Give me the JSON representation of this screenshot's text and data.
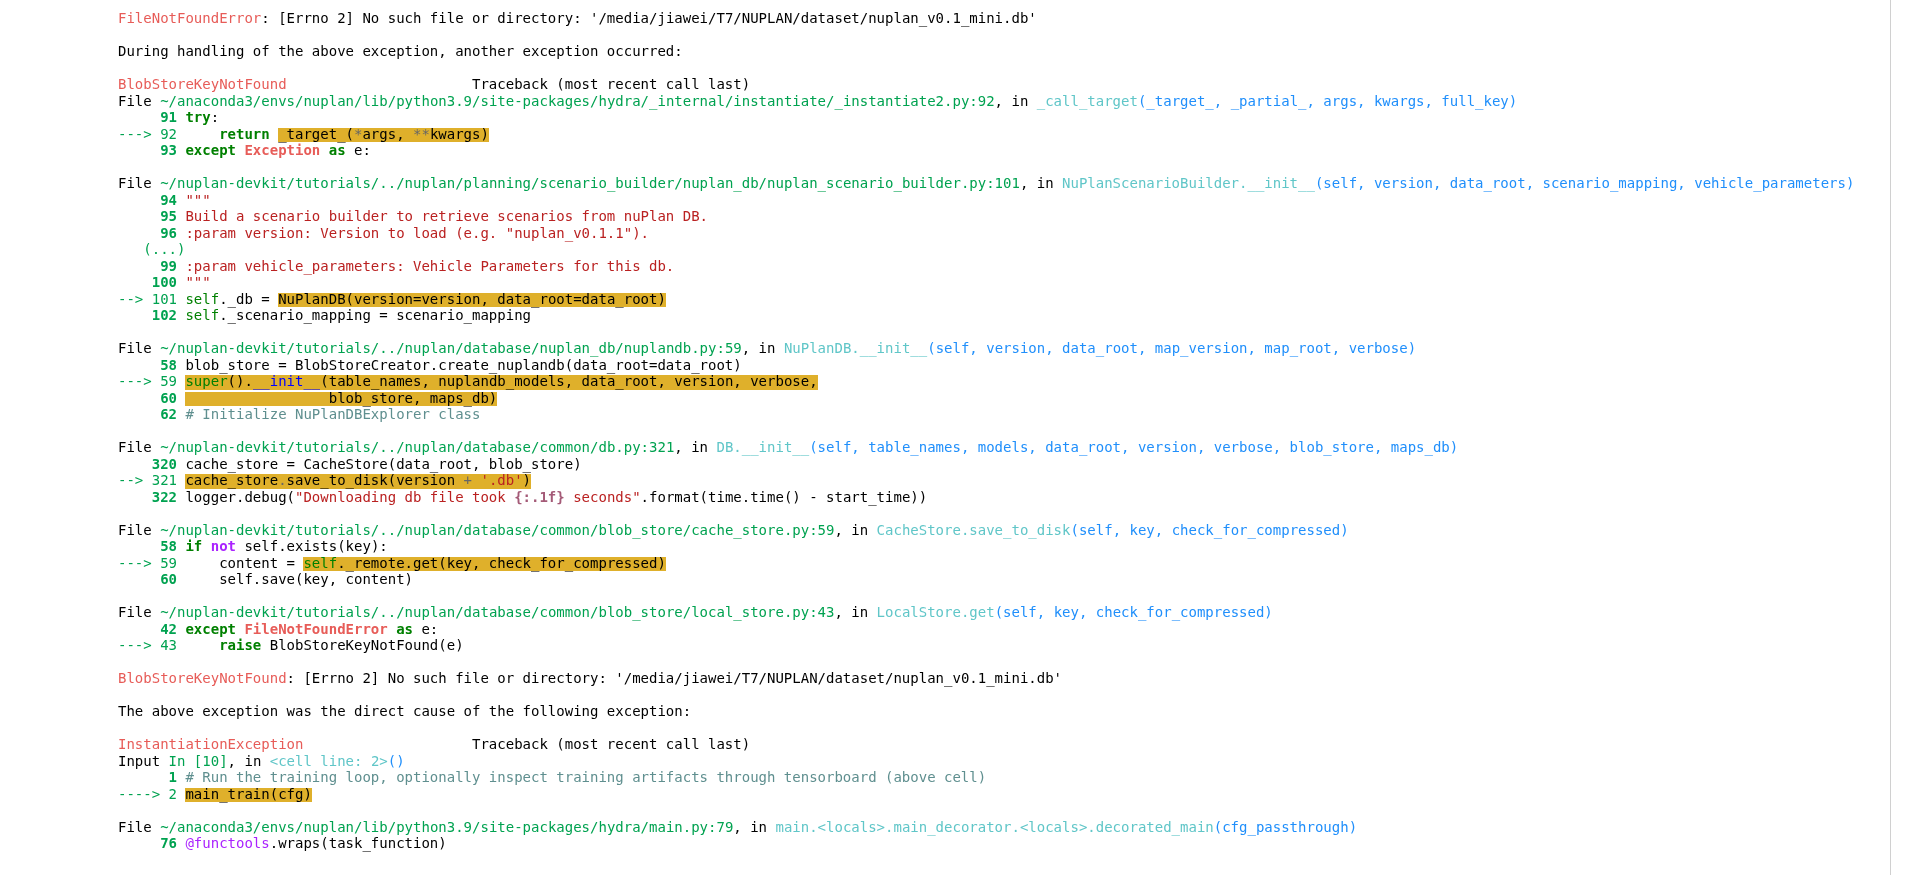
{
  "blocks": [
    {
      "lines": [
        {
          "kind": "text",
          "segments": [
            {
              "text": "FileNotFoundError",
              "kind": "ename",
              "highlighted": false
            },
            {
              "text": ": [Errno 2] No such file or directory: '/media/jiawei/T7/NUPLAN/dataset/nuplan_v0.1_mini.db'",
              "kind": "plain",
              "highlighted": false
            }
          ]
        }
      ]
    },
    {
      "lines": [
        {
          "kind": "text",
          "segments": [
            {
              "text": "During handling of the above exception, another exception occurred:",
              "kind": "plain",
              "highlighted": false
            }
          ]
        }
      ]
    },
    {
      "lines": [
        {
          "kind": "header",
          "exception": "BlobStoreKeyNotFound",
          "label": "Traceback (most recent call last)"
        },
        {
          "kind": "text",
          "segments": [
            {
              "text": "File ",
              "kind": "plain",
              "highlighted": false
            },
            {
              "text": "~/anaconda3/envs/nuplan/lib/python3.9/site-packages/hydra/_internal/instantiate/_instantiate2.py:92",
              "kind": "path",
              "highlighted": false
            },
            {
              "text": ", in ",
              "kind": "plain",
              "highlighted": false
            },
            {
              "text": "_call_target",
              "kind": "func",
              "highlighted": false
            },
            {
              "text": "(_target_, _partial_, args, kwargs, full_key)",
              "kind": "args",
              "highlighted": false
            }
          ]
        },
        {
          "kind": "code",
          "number": "91",
          "segments": [
            {
              "text": "try",
              "kind": "keyword",
              "highlighted": false
            },
            {
              "text": ":",
              "kind": "plain",
              "highlighted": false
            }
          ]
        },
        {
          "kind": "code",
          "arrow": "--->",
          "number": "92",
          "segments": [
            {
              "text": "    return ",
              "kind": "keyword",
              "highlighted": false
            },
            {
              "text": "_target_(",
              "kind": "plain",
              "highlighted": true
            },
            {
              "text": "*",
              "kind": "operator",
              "highlighted": true
            },
            {
              "text": "args, ",
              "kind": "plain",
              "highlighted": true
            },
            {
              "text": "**",
              "kind": "operator",
              "highlighted": true
            },
            {
              "text": "kwargs)",
              "kind": "plain",
              "highlighted": true
            }
          ]
        },
        {
          "kind": "code",
          "number": "93",
          "segments": [
            {
              "text": "except ",
              "kind": "keyword",
              "highlighted": false
            },
            {
              "text": "Exception ",
              "kind": "exception",
              "highlighted": false
            },
            {
              "text": "as",
              "kind": "keyword",
              "highlighted": false
            },
            {
              "text": " e:",
              "kind": "plain",
              "highlighted": false
            }
          ]
        }
      ]
    },
    {
      "lines": [
        {
          "kind": "text",
          "segments": [
            {
              "text": "File ",
              "kind": "plain",
              "highlighted": false
            },
            {
              "text": "~/nuplan-devkit/tutorials/../nuplan/planning/scenario_builder/nuplan_db/nuplan_scenario_builder.py:101",
              "kind": "path",
              "highlighted": false
            },
            {
              "text": ", in ",
              "kind": "plain",
              "highlighted": false
            },
            {
              "text": "NuPlanScenarioBuilder.__init__",
              "kind": "func",
              "highlighted": false
            },
            {
              "text": "(self, version, data_root, scenario_mapping, vehicle_parameters)",
              "kind": "args",
              "highlighted": false
            }
          ]
        },
        {
          "kind": "code",
          "number": "94",
          "segments": [
            {
              "text": "\"\"\"",
              "kind": "string",
              "highlighted": false
            }
          ]
        },
        {
          "kind": "code",
          "number": "95",
          "segments": [
            {
              "text": "Build a scenario builder to retrieve scenarios from nuPlan DB.",
              "kind": "string",
              "highlighted": false
            }
          ]
        },
        {
          "kind": "code",
          "number": "96",
          "segments": [
            {
              "text": ":param version: Version to load (e.g. \"nuplan_v0.1.1\").",
              "kind": "string",
              "highlighted": false
            }
          ]
        },
        {
          "kind": "ellipsis",
          "text": "(...)"
        },
        {
          "kind": "code",
          "number": "99",
          "segments": [
            {
              "text": ":param vehicle_parameters: Vehicle Parameters for this db.",
              "kind": "string",
              "highlighted": false
            }
          ]
        },
        {
          "kind": "code",
          "number": "100",
          "segments": [
            {
              "text": "\"\"\"",
              "kind": "string",
              "highlighted": false
            }
          ]
        },
        {
          "kind": "code",
          "arrow": "-->",
          "number": "101",
          "segments": [
            {
              "text": "self",
              "kind": "builtin",
              "highlighted": false
            },
            {
              "text": "._db = ",
              "kind": "plain",
              "highlighted": false
            },
            {
              "text": "NuPlanDB(version=version, data_root=data_root)",
              "kind": "plain",
              "highlighted": true
            }
          ]
        },
        {
          "kind": "code",
          "number": "102",
          "segments": [
            {
              "text": "self",
              "kind": "builtin",
              "highlighted": false
            },
            {
              "text": "._scenario_mapping = scenario_mapping",
              "kind": "plain",
              "highlighted": false
            }
          ]
        }
      ]
    },
    {
      "lines": [
        {
          "kind": "text",
          "segments": [
            {
              "text": "File ",
              "kind": "plain",
              "highlighted": false
            },
            {
              "text": "~/nuplan-devkit/tutorials/../nuplan/database/nuplan_db/nuplandb.py:59",
              "kind": "path",
              "highlighted": false
            },
            {
              "text": ", in ",
              "kind": "plain",
              "highlighted": false
            },
            {
              "text": "NuPlanDB.__init__",
              "kind": "func",
              "highlighted": false
            },
            {
              "text": "(self, version, data_root, map_version, map_root, verbose)",
              "kind": "args",
              "highlighted": false
            }
          ]
        },
        {
          "kind": "code",
          "number": "58",
          "segments": [
            {
              "text": "blob_store = BlobStoreCreator.create_nuplandb(data_root=data_root)",
              "kind": "plain",
              "highlighted": false
            }
          ]
        },
        {
          "kind": "code",
          "arrow": "--->",
          "number": "59",
          "segments": [
            {
              "text": "super",
              "kind": "builtin",
              "highlighted": true
            },
            {
              "text": "().",
              "kind": "plain",
              "highlighted": true
            },
            {
              "text": "__init__",
              "kind": "dunder",
              "highlighted": true
            },
            {
              "text": "(table_names, nuplandb_models, data_root, version, verbose,",
              "kind": "plain",
              "highlighted": true
            }
          ]
        },
        {
          "kind": "code",
          "number": "60",
          "segments": [
            {
              "text": "                 blob_store, maps_db)",
              "kind": "plain",
              "highlighted": true
            }
          ]
        },
        {
          "kind": "code",
          "number": "62",
          "segments": [
            {
              "text": "# Initialize NuPlanDBExplorer class",
              "kind": "comment",
              "highlighted": false
            }
          ]
        }
      ]
    },
    {
      "lines": [
        {
          "kind": "text",
          "segments": [
            {
              "text": "File ",
              "kind": "plain",
              "highlighted": false
            },
            {
              "text": "~/nuplan-devkit/tutorials/../nuplan/database/common/db.py:321",
              "kind": "path",
              "highlighted": false
            },
            {
              "text": ", in ",
              "kind": "plain",
              "highlighted": false
            },
            {
              "text": "DB.__init__",
              "kind": "func",
              "highlighted": false
            },
            {
              "text": "(self, table_names, models, data_root, version, verbose, blob_store, maps_db)",
              "kind": "args",
              "highlighted": false
            }
          ]
        },
        {
          "kind": "code",
          "number": "320",
          "segments": [
            {
              "text": "cache_store = CacheStore(data_root, blob_store)",
              "kind": "plain",
              "highlighted": false
            }
          ]
        },
        {
          "kind": "code",
          "arrow": "-->",
          "number": "321",
          "segments": [
            {
              "text": "cache_store",
              "kind": "plain",
              "highlighted": true
            },
            {
              "text": ".",
              "kind": "operator",
              "highlighted": true
            },
            {
              "text": "save_to_disk(version ",
              "kind": "plain",
              "highlighted": true
            },
            {
              "text": "+ ",
              "kind": "operator",
              "highlighted": true
            },
            {
              "text": "'.db'",
              "kind": "string",
              "highlighted": true
            },
            {
              "text": ")",
              "kind": "plain",
              "highlighted": true
            }
          ]
        },
        {
          "kind": "code",
          "number": "322",
          "segments": [
            {
              "text": "logger.debug(",
              "kind": "plain",
              "highlighted": false
            },
            {
              "text": "\"Downloading db file took ",
              "kind": "string",
              "highlighted": false
            },
            {
              "text": "{:.1f}",
              "kind": "interpolation",
              "highlighted": false
            },
            {
              "text": " seconds\"",
              "kind": "string",
              "highlighted": false
            },
            {
              "text": ".format(time.time() - start_time))",
              "kind": "plain",
              "highlighted": false
            }
          ]
        }
      ]
    },
    {
      "lines": [
        {
          "kind": "text",
          "segments": [
            {
              "text": "File ",
              "kind": "plain",
              "highlighted": false
            },
            {
              "text": "~/nuplan-devkit/tutorials/../nuplan/database/common/blob_store/cache_store.py:59",
              "kind": "path",
              "highlighted": false
            },
            {
              "text": ", in ",
              "kind": "plain",
              "highlighted": false
            },
            {
              "text": "CacheStore.save_to_disk",
              "kind": "func",
              "highlighted": false
            },
            {
              "text": "(self, key, check_for_compressed)",
              "kind": "args",
              "highlighted": false
            }
          ]
        },
        {
          "kind": "code",
          "number": "58",
          "segments": [
            {
              "text": "if ",
              "kind": "keyword",
              "highlighted": false
            },
            {
              "text": "not",
              "kind": "wordop",
              "highlighted": false
            },
            {
              "text": " self.exists(key):",
              "kind": "plain",
              "highlighted": false
            }
          ]
        },
        {
          "kind": "code",
          "arrow": "--->",
          "number": "59",
          "segments": [
            {
              "text": "    content = ",
              "kind": "plain",
              "highlighted": false
            },
            {
              "text": "self",
              "kind": "builtin",
              "highlighted": true
            },
            {
              "text": "._remote.get(key, check_for_compressed)",
              "kind": "plain",
              "highlighted": true
            }
          ]
        },
        {
          "kind": "code",
          "number": "60",
          "segments": [
            {
              "text": "    self.save(key, content)",
              "kind": "plain",
              "highlighted": false
            }
          ]
        }
      ]
    },
    {
      "lines": [
        {
          "kind": "text",
          "segments": [
            {
              "text": "File ",
              "kind": "plain",
              "highlighted": false
            },
            {
              "text": "~/nuplan-devkit/tutorials/../nuplan/database/common/blob_store/local_store.py:43",
              "kind": "path",
              "highlighted": false
            },
            {
              "text": ", in ",
              "kind": "plain",
              "highlighted": false
            },
            {
              "text": "LocalStore.get",
              "kind": "func",
              "highlighted": false
            },
            {
              "text": "(self, key, check_for_compressed)",
              "kind": "args",
              "highlighted": false
            }
          ]
        },
        {
          "kind": "code",
          "number": "42",
          "segments": [
            {
              "text": "except ",
              "kind": "keyword",
              "highlighted": false
            },
            {
              "text": "FileNotFoundError ",
              "kind": "exception",
              "highlighted": false
            },
            {
              "text": "as",
              "kind": "keyword",
              "highlighted": false
            },
            {
              "text": " e:",
              "kind": "plain",
              "highlighted": false
            }
          ]
        },
        {
          "kind": "code",
          "arrow": "--->",
          "number": "43",
          "segments": [
            {
              "text": "    raise",
              "kind": "keyword",
              "highlighted": false
            },
            {
              "text": " BlobStoreKeyNotFound(e)",
              "kind": "plain",
              "highlighted": false
            }
          ]
        }
      ]
    },
    {
      "lines": [
        {
          "kind": "text",
          "segments": [
            {
              "text": "BlobStoreKeyNotFound",
              "kind": "ename",
              "highlighted": false
            },
            {
              "text": ": [Errno 2] No such file or directory: '/media/jiawei/T7/NUPLAN/dataset/nuplan_v0.1_mini.db'",
              "kind": "plain",
              "highlighted": false
            }
          ]
        }
      ]
    },
    {
      "lines": [
        {
          "kind": "text",
          "segments": [
            {
              "text": "The above exception was the direct cause of the following exception:",
              "kind": "plain",
              "highlighted": false
            }
          ]
        }
      ]
    },
    {
      "lines": [
        {
          "kind": "header",
          "exception": "InstantiationException",
          "label": "Traceback (most recent call last)"
        },
        {
          "kind": "text",
          "segments": [
            {
              "text": "Input ",
              "kind": "plain",
              "highlighted": false
            },
            {
              "text": "In [10]",
              "kind": "path",
              "highlighted": false
            },
            {
              "text": ", in ",
              "kind": "plain",
              "highlighted": false
            },
            {
              "text": "<cell line: 2>",
              "kind": "func",
              "highlighted": false
            },
            {
              "text": "()",
              "kind": "args",
              "highlighted": false
            }
          ]
        },
        {
          "kind": "code",
          "number": "1",
          "segments": [
            {
              "text": "# Run the training loop, optionally inspect training artifacts through tensorboard (above cell)",
              "kind": "comment",
              "highlighted": false
            }
          ]
        },
        {
          "kind": "code",
          "arrow": "---->",
          "number": "2",
          "segments": [
            {
              "text": "main_train(cfg)",
              "kind": "plain",
              "highlighted": true
            }
          ]
        }
      ]
    },
    {
      "lines": [
        {
          "kind": "text",
          "segments": [
            {
              "text": "File ",
              "kind": "plain",
              "highlighted": false
            },
            {
              "text": "~/anaconda3/envs/nuplan/lib/python3.9/site-packages/hydra/main.py:79",
              "kind": "path",
              "highlighted": false
            },
            {
              "text": ", in ",
              "kind": "plain",
              "highlighted": false
            },
            {
              "text": "main.<locals>.main_decorator.<locals>.decorated_main",
              "kind": "func",
              "highlighted": false
            },
            {
              "text": "(cfg_passthrough)",
              "kind": "args",
              "highlighted": false
            }
          ]
        },
        {
          "kind": "code",
          "number": "76",
          "segments": [
            {
              "text": "@functools",
              "kind": "decorator",
              "highlighted": false
            },
            {
              "text": ".wraps(task_function)",
              "kind": "plain",
              "highlighted": false
            }
          ]
        }
      ]
    }
  ]
}
